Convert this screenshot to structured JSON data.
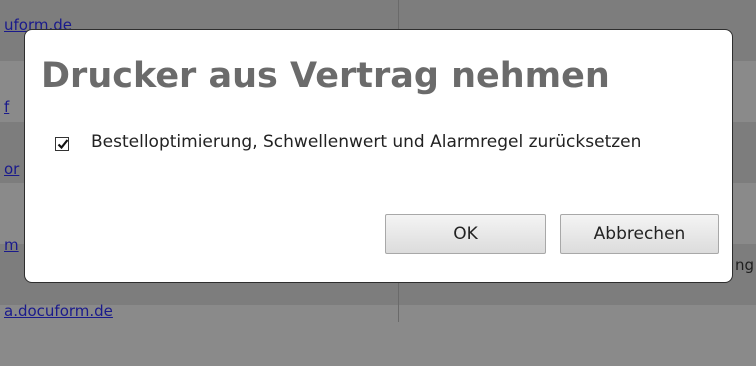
{
  "background": {
    "links": [
      "uform.de",
      "f",
      "or",
      "m",
      "a.docuform.de"
    ],
    "right_text": "ng"
  },
  "dialog": {
    "title": "Drucker aus Vertrag nehmen",
    "checkbox": {
      "checked": true,
      "label": "Bestelloptimierung, Schwellenwert und Alarmregel zurücksetzen"
    },
    "buttons": {
      "ok": "OK",
      "cancel": "Abbrechen"
    }
  }
}
